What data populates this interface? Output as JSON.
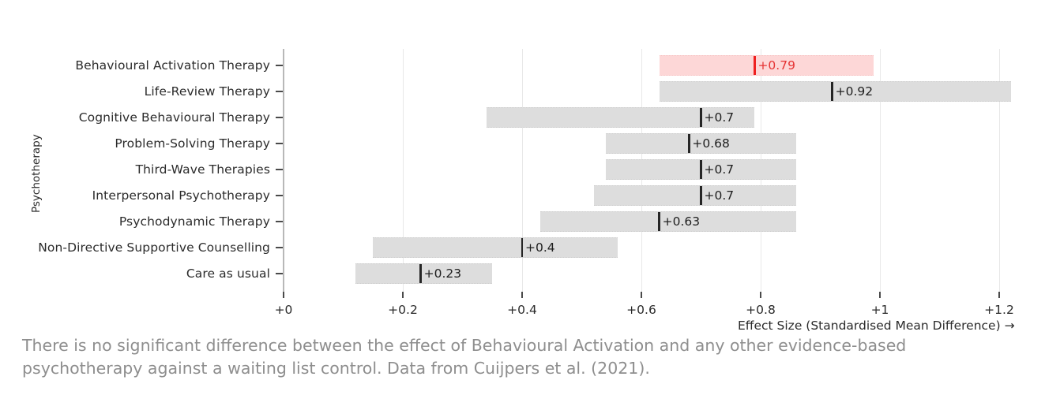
{
  "chart_data": {
    "type": "bar",
    "title": "",
    "subtitle": "",
    "xlabel": "Effect Size (Standardised Mean Difference) →",
    "ylabel": "Psychotherapy",
    "xlim": [
      0,
      1.26
    ],
    "xticks": [
      0,
      0.2,
      0.4,
      0.6,
      0.8,
      1.0,
      1.2
    ],
    "xticklabels": [
      "+0",
      "+0.2",
      "+0.4",
      "+0.6",
      "+0.8",
      "+1",
      "+1.2"
    ],
    "grid": "vertical",
    "legend": "none",
    "orientation": "horizontal",
    "categories": [
      "Behavioural Activation Therapy",
      "Life-Review Therapy",
      "Cognitive Behavioural Therapy",
      "Problem-Solving Therapy",
      "Third-Wave Therapies",
      "Interpersonal Psychotherapy",
      "Psychodynamic Therapy",
      "Non-Directive Supportive Counselling",
      "Care as usual"
    ],
    "values": [
      0.79,
      0.92,
      0.7,
      0.68,
      0.7,
      0.7,
      0.63,
      0.4,
      0.23
    ],
    "ci_low": [
      0.63,
      0.63,
      0.34,
      0.54,
      0.54,
      0.52,
      0.43,
      0.15,
      0.12
    ],
    "ci_high": [
      0.99,
      1.22,
      0.79,
      0.86,
      0.86,
      0.86,
      0.86,
      0.56,
      0.35
    ],
    "series": [
      {
        "name": "Behavioural Activation Therapy",
        "label": "+0.79",
        "value": 0.79,
        "low": 0.63,
        "high": 0.99,
        "highlight": true
      },
      {
        "name": "Life-Review Therapy",
        "label": "+0.92",
        "value": 0.92,
        "low": 0.63,
        "high": 1.22,
        "highlight": false
      },
      {
        "name": "Cognitive Behavioural Therapy",
        "label": "+0.7",
        "value": 0.7,
        "low": 0.34,
        "high": 0.79,
        "highlight": false
      },
      {
        "name": "Problem-Solving Therapy",
        "label": "+0.68",
        "value": 0.68,
        "low": 0.54,
        "high": 0.86,
        "highlight": false
      },
      {
        "name": "Third-Wave Therapies",
        "label": "+0.7",
        "value": 0.7,
        "low": 0.54,
        "high": 0.86,
        "highlight": false
      },
      {
        "name": "Interpersonal Psychotherapy",
        "label": "+0.7",
        "value": 0.7,
        "low": 0.52,
        "high": 0.86,
        "highlight": false
      },
      {
        "name": "Psychodynamic Therapy",
        "label": "+0.63",
        "value": 0.63,
        "low": 0.43,
        "high": 0.86,
        "highlight": false
      },
      {
        "name": "Non-Directive Supportive Counselling",
        "label": "+0.4",
        "value": 0.4,
        "low": 0.15,
        "high": 0.56,
        "highlight": false
      },
      {
        "name": "Care as usual",
        "label": "+0.23",
        "value": 0.23,
        "low": 0.12,
        "high": 0.35,
        "highlight": false
      }
    ],
    "colors": {
      "bar": "#dddddd",
      "highlight_bar": "#fdd7d7",
      "point": "#262626",
      "highlight_point": "#ef2020",
      "highlight_label": "#e53434",
      "grid": "#e8e8e8",
      "axis": "#b8b8b8",
      "text": "#2b2b2b",
      "caption": "#8e8e8e"
    }
  },
  "caption": {
    "text": "There is no significant difference between the effect of Behavioural Activation and any other evidence-based psychotherapy against a waiting list control. Data from Cuijpers et al. (2021)."
  }
}
